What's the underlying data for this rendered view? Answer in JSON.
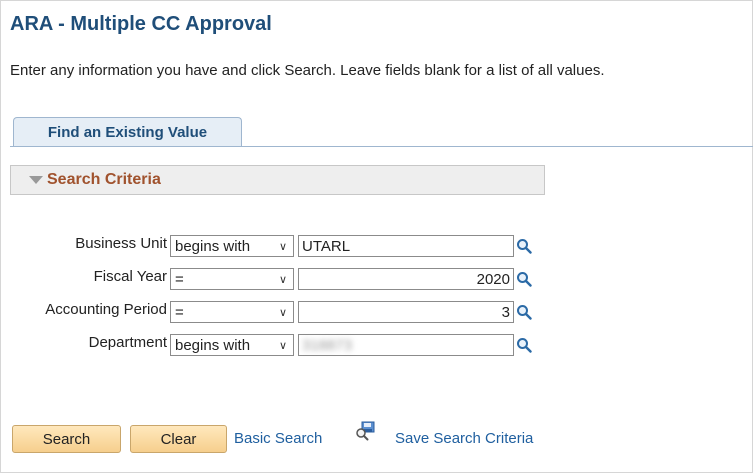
{
  "page": {
    "title": "ARA - Multiple CC Approval",
    "instructions": "Enter any information you have and click Search. Leave fields blank for a list of all values."
  },
  "tab": {
    "label": "Find an Existing Value"
  },
  "section": {
    "label": "Search Criteria",
    "icon": "collapse-triangle-icon"
  },
  "fields": [
    {
      "label": "Business Unit",
      "operator": "begins with",
      "value": "UTARL",
      "align": "left",
      "blurred": false
    },
    {
      "label": "Fiscal Year",
      "operator": "=",
      "value": "2020",
      "align": "right",
      "blurred": false
    },
    {
      "label": "Accounting Period",
      "operator": "=",
      "value": "3",
      "align": "right",
      "blurred": false
    },
    {
      "label": "Department",
      "operator": "begins with",
      "value": "318873",
      "align": "left",
      "blurred": true
    }
  ],
  "buttons": {
    "search": "Search",
    "clear": "Clear"
  },
  "links": {
    "basic_search": "Basic Search",
    "save_search": "Save Search Criteria"
  },
  "colors": {
    "title": "#1f4e79",
    "section_label": "#a0522d",
    "link": "#1f5f9f",
    "button": "#f6cf8d"
  }
}
